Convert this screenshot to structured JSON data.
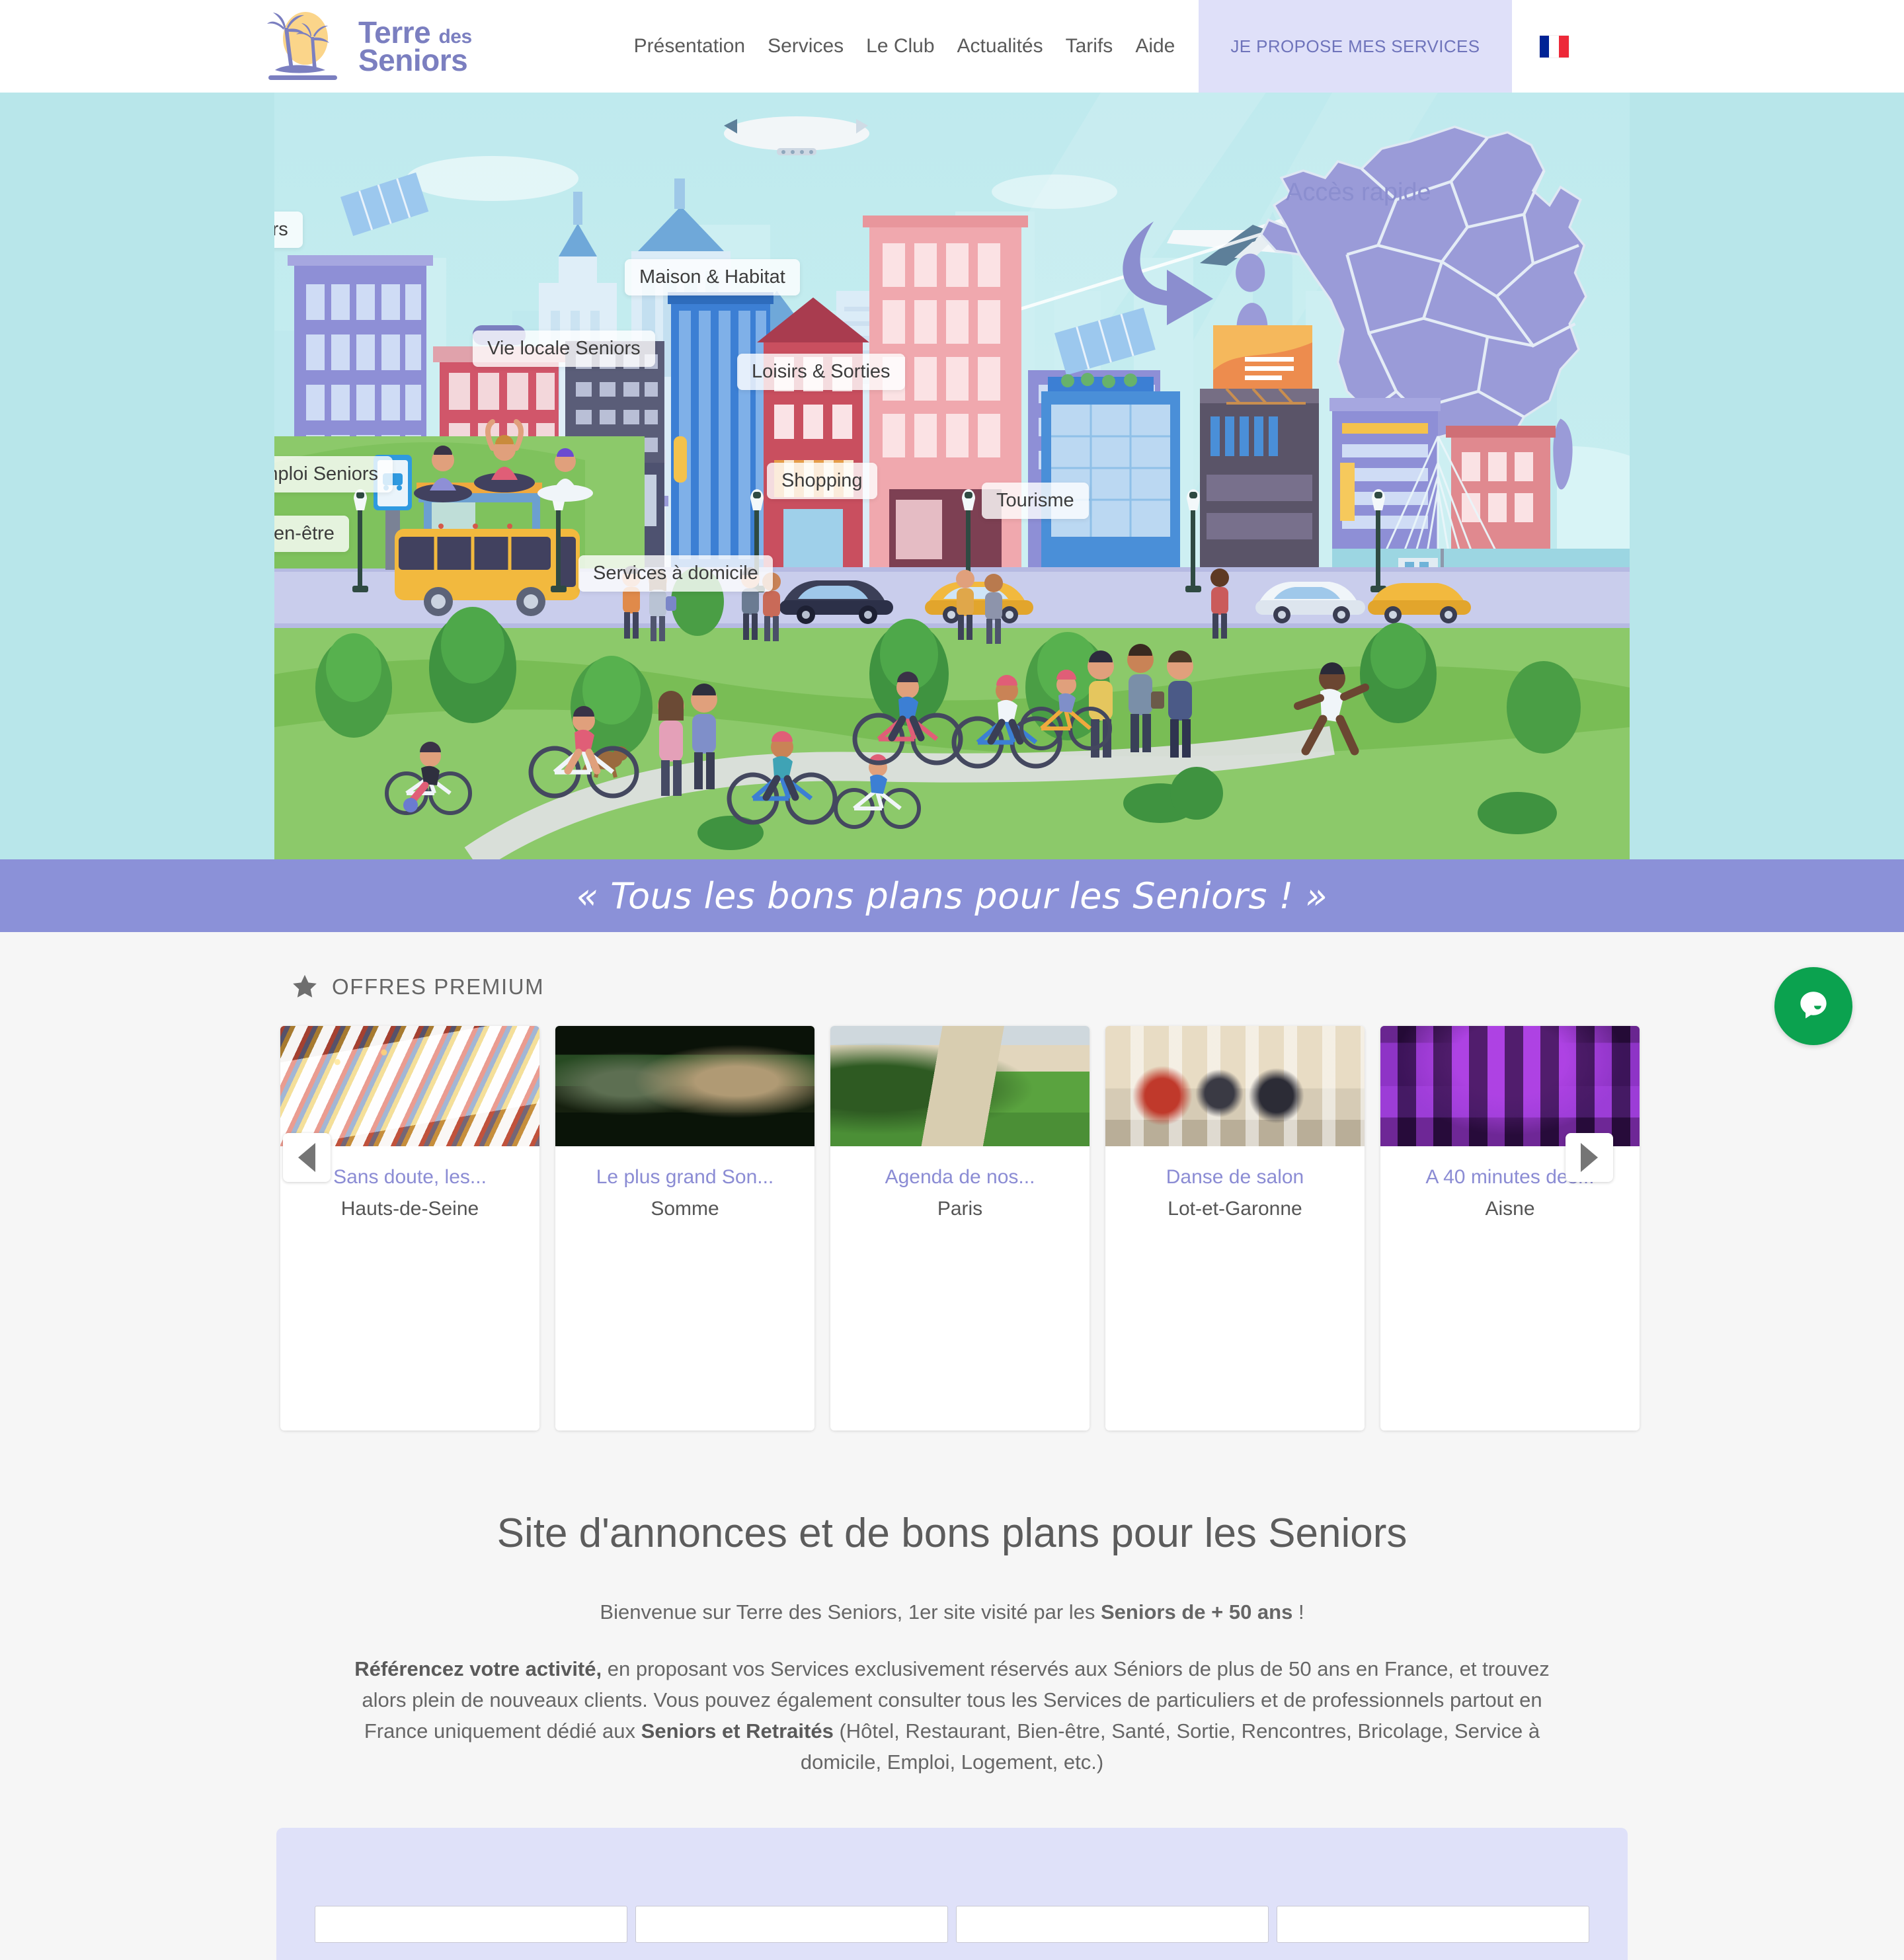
{
  "header": {
    "logo": {
      "line1": "Terre",
      "line1_small": "des",
      "line2": "Seniors",
      "icon": "palm-sun-logo"
    },
    "nav": [
      {
        "label": "Présentation"
      },
      {
        "label": "Services"
      },
      {
        "label": "Le Club"
      },
      {
        "label": "Actualités"
      },
      {
        "label": "Tarifs"
      },
      {
        "label": "Aide"
      }
    ],
    "cta_label": "JE PROPOSE MES SERVICES",
    "flag": "france-flag-icon",
    "colors": {
      "cta_bg": "#dfe0f9",
      "cta_text": "#6f74bb",
      "logo_purple": "#7b7fc0"
    }
  },
  "hero": {
    "access_label": "Accès rapide",
    "map_label": "france-map",
    "pills": [
      {
        "label": "Cours Seniors"
      },
      {
        "label": "Maison & Habitat"
      },
      {
        "label": "Vie locale Seniors"
      },
      {
        "label": "Emploi Seniors"
      },
      {
        "label": "Loisirs & Sorties"
      },
      {
        "label": "Shopping"
      },
      {
        "label": "Tourisme"
      },
      {
        "label": "Santé & Bien-être"
      },
      {
        "label": "Services à domicile"
      }
    ],
    "sky_color": "#b8e6ea",
    "map_color": "#9a9bd8"
  },
  "tagline": {
    "text": "« Tous les bons plans pour les Seniors ! »",
    "bg": "#8b91d8"
  },
  "premium": {
    "section_title": "OFFRES PREMIUM",
    "star_icon": "star-icon",
    "prev_icon": "chevron-left-icon",
    "next_icon": "chevron-right-icon",
    "cards": [
      {
        "title": "Sans doute, les...",
        "location": "Hauts-de-Seine",
        "image": "festive-table-setting"
      },
      {
        "title": "Le plus grand Son...",
        "location": "Somme",
        "image": "horse-drawn-cart-night"
      },
      {
        "title": "Agenda de nos...",
        "location": "Paris",
        "image": "manor-house-garden"
      },
      {
        "title": "Danse de salon",
        "location": "Lot-et-Garonne",
        "image": "ballroom-dancers"
      },
      {
        "title": "A 40 minutes des...",
        "location": "Aisne",
        "image": "chateau-purple-lights"
      }
    ],
    "title_color": "#8b8cd4"
  },
  "intro": {
    "heading": "Site d'annonces et de bons plans pour les Seniors",
    "lead_pre": "Bienvenue sur Terre des Seniors, 1er site visité par les ",
    "lead_bold": "Seniors de + 50 ans",
    "lead_post": " !",
    "para_b1": "Référencez votre activité,",
    "para_t1": " en proposant vos Services exclusivement réservés aux Séniors de plus de 50 ans en France, et trouvez alors plein de nouveaux clients. Vous pouvez également consulter tous les Services de particuliers et de professionnels partout en France uniquement dédié aux ",
    "para_b2": "Seniors et Retraités",
    "para_t2": " (Hôtel, Restaurant, Bien-être, Santé, Sortie, Rencontres, Bricolage, Service à domicile, Emploi, Logement, etc.)"
  },
  "search_panel": {
    "bg": "#dfe1f9",
    "fields": [
      "",
      "",
      "",
      ""
    ]
  },
  "chat": {
    "icon": "chat-bubble-icon",
    "color": "#0ba24f"
  }
}
